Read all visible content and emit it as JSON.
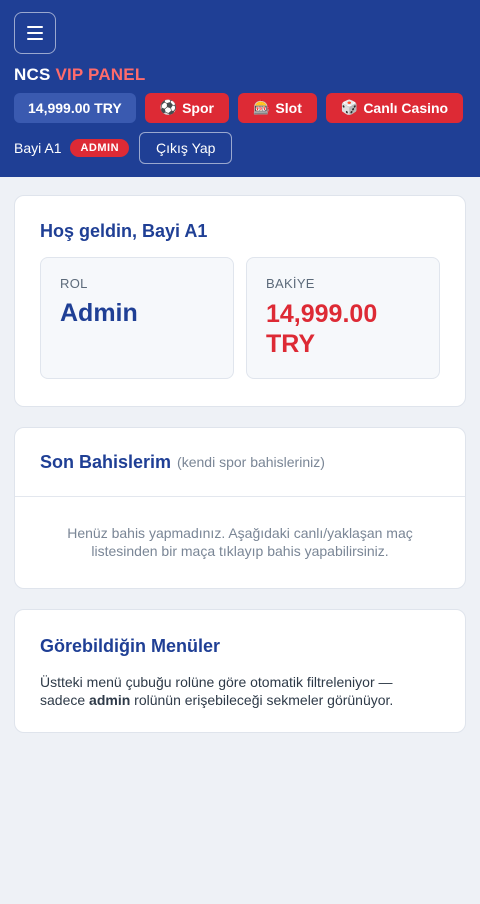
{
  "header": {
    "brand_primary": "NCS",
    "brand_accent": "VIP PANEL",
    "balance": "14,999.00 TRY",
    "nav": [
      {
        "icon": "⚽",
        "label": "Spor"
      },
      {
        "icon": "🎰",
        "label": "Slot"
      },
      {
        "icon": "🎲",
        "label": "Canlı Casino"
      }
    ],
    "user_name": "Bayi A1",
    "role_badge": "ADMIN",
    "logout_label": "Çıkış Yap"
  },
  "welcome": {
    "title": "Hoş geldin, Bayi A1",
    "role_label": "ROL",
    "role_value": "Admin",
    "balance_label": "BAKİYE",
    "balance_value": "14,999.00 TRY"
  },
  "bets": {
    "title": "Son Bahislerim",
    "subtitle": "(kendi spor bahisleriniz)",
    "empty_text": "Henüz bahis yapmadınız. Aşağıdaki canlı/yaklaşan maç listesinden bir maça tıklayıp bahis yapabilirsiniz."
  },
  "menus": {
    "title": "Görebildiğin Menüler",
    "text_before": "Üstteki menü çubuğu rolüne göre otomatik filtreleniyor — sadece ",
    "text_bold": "admin",
    "text_after": " rolünün erişebileceği sekmeler görünüyor."
  },
  "colors": {
    "header_bg": "#1f3f95",
    "accent_red": "#dd2a35",
    "brand_accent": "#ff6b6b"
  }
}
